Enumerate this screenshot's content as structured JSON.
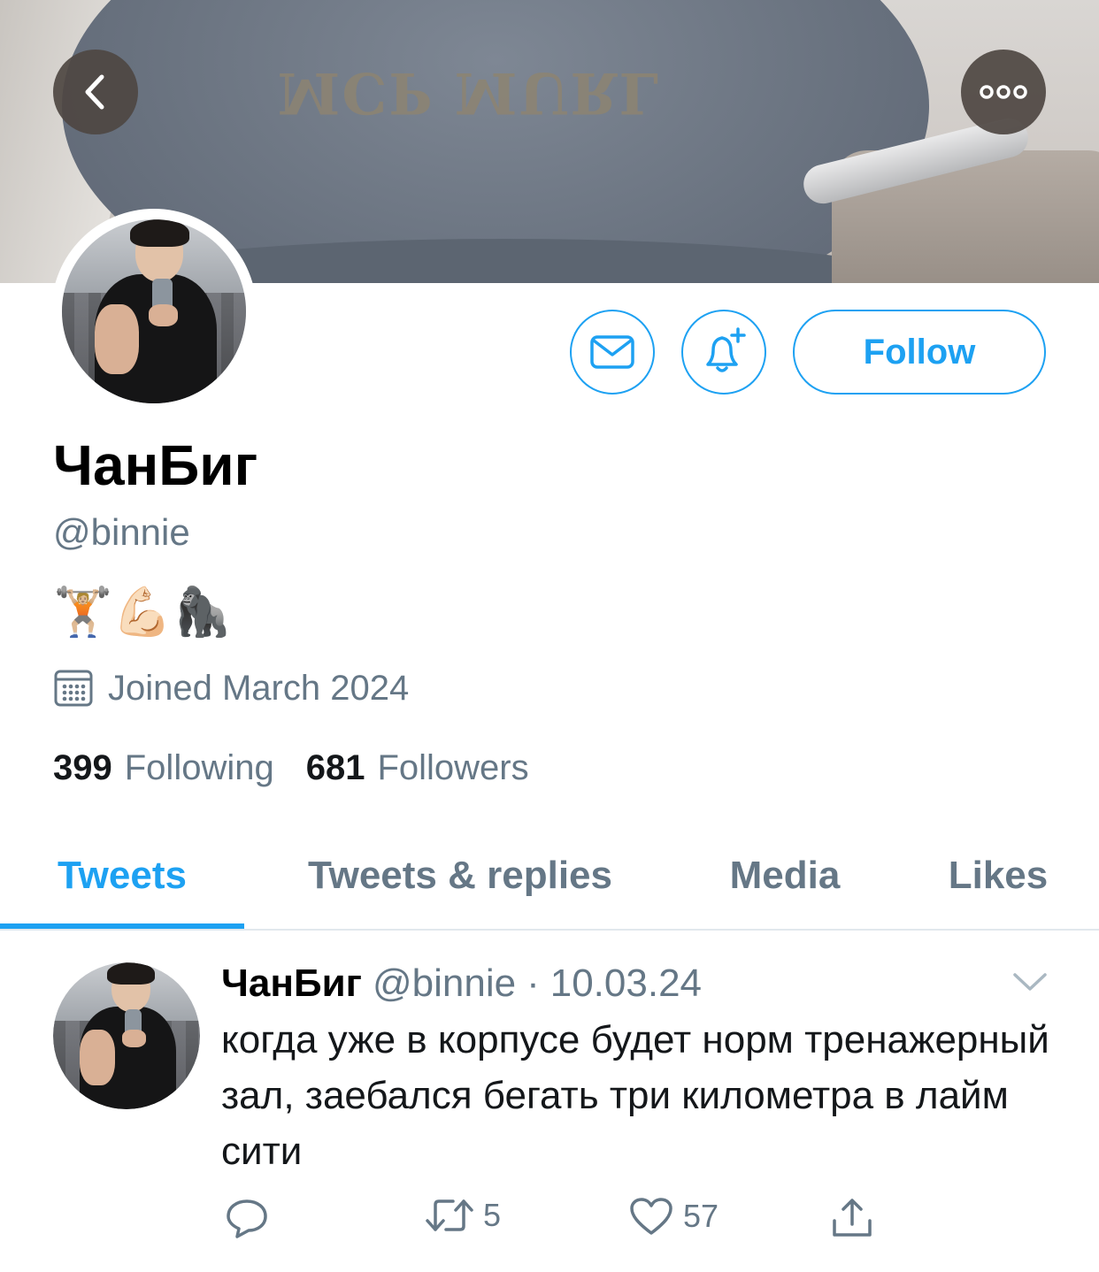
{
  "header": {
    "back_icon": "chevron-left-icon",
    "more_icon": "more-horizontal-icon",
    "banner_cap_text": "MCP MURL"
  },
  "profile": {
    "display_name": "ЧанБиг",
    "handle": "@binnie",
    "bio": "🏋🏼💪🏻🦍",
    "joined": "Joined March 2024",
    "following_count": "399",
    "following_label": "Following",
    "followers_count": "681",
    "followers_label": "Followers"
  },
  "actions": {
    "message_icon": "envelope-icon",
    "notify_icon": "bell-plus-icon",
    "follow_label": "Follow"
  },
  "tabs": [
    {
      "label": "Tweets",
      "active": true
    },
    {
      "label": "Tweets & replies",
      "active": false
    },
    {
      "label": "Media",
      "active": false
    },
    {
      "label": "Likes",
      "active": false
    }
  ],
  "tweet": {
    "name": "ЧанБиг",
    "handle": "@binnie",
    "separator": "·",
    "date": "10.03.24",
    "text": "когда уже в корпусе будет норм тренажерный зал, заебался бегать три километра в лайм сити",
    "reply_count": "",
    "retweet_count": "5",
    "like_count": "57"
  },
  "colors": {
    "accent": "#1da1f2",
    "secondary_text": "#657786",
    "primary_text": "#14171a",
    "divider": "#e1e8ed"
  }
}
